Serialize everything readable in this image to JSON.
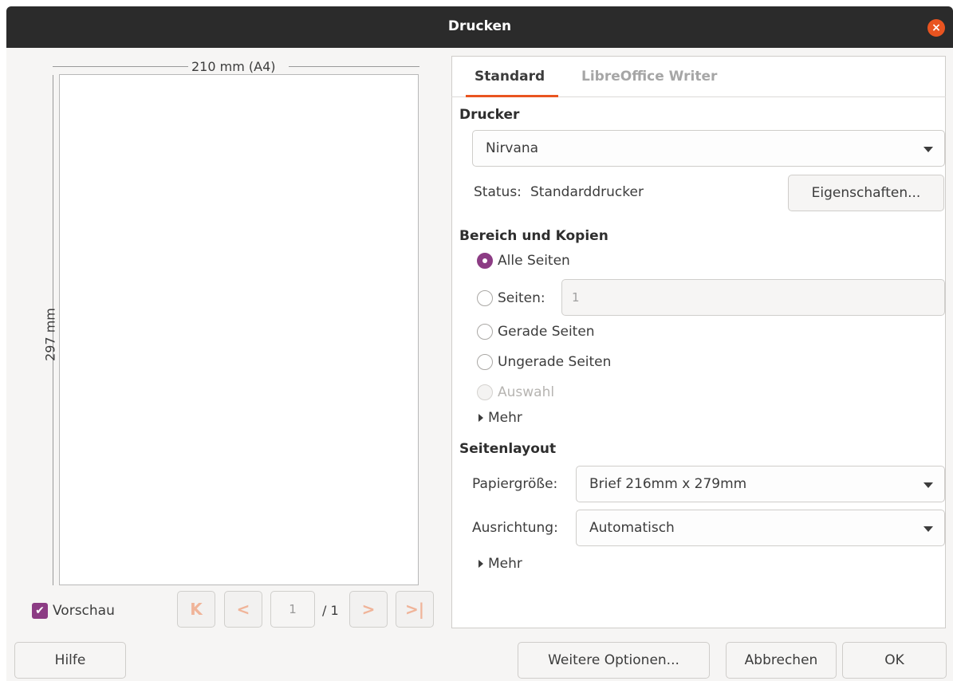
{
  "window": {
    "title": "Drucken",
    "close_icon": "×"
  },
  "preview": {
    "width_label": "210 mm (A4)",
    "height_label": "297 mm",
    "preview_checkbox_label": "Vorschau",
    "preview_checked": true,
    "current_page": "1",
    "page_total": "/ 1",
    "nav_first": "K",
    "nav_prev": "<",
    "nav_next": ">",
    "nav_last": ">|"
  },
  "tabs": [
    {
      "label": "Standard",
      "active": true
    },
    {
      "label": "LibreOffice Writer",
      "active": false
    }
  ],
  "printer": {
    "section_title": "Drucker",
    "selected_printer": "Nirvana",
    "status_label": "Status:",
    "status_value": "Standarddrucker",
    "properties_button": "Eigenschaften..."
  },
  "range": {
    "section_title": "Bereich und Kopien",
    "options": [
      {
        "label": "Alle Seiten",
        "selected": true,
        "enabled": true
      },
      {
        "label": "Seiten:",
        "selected": false,
        "enabled": true
      },
      {
        "label": "Gerade Seiten",
        "selected": false,
        "enabled": true
      },
      {
        "label": "Ungerade Seiten",
        "selected": false,
        "enabled": true
      },
      {
        "label": "Auswahl",
        "selected": false,
        "enabled": false
      }
    ],
    "pages_value": "1",
    "more_label": "Mehr"
  },
  "layout": {
    "section_title": "Seitenlayout",
    "paper_size_label": "Papiergröße:",
    "paper_size_value": "Brief 216mm x 279mm",
    "orientation_label": "Ausrichtung:",
    "orientation_value": "Automatisch",
    "more_label": "Mehr"
  },
  "footer": {
    "help_button": "Hilfe",
    "more_options_button": "Weitere Optionen...",
    "cancel_button": "Abbrechen",
    "ok_button": "OK"
  },
  "colors": {
    "accent": "#e95420",
    "checked": "#8c3c84",
    "titlebar": "#2b2b2b"
  }
}
